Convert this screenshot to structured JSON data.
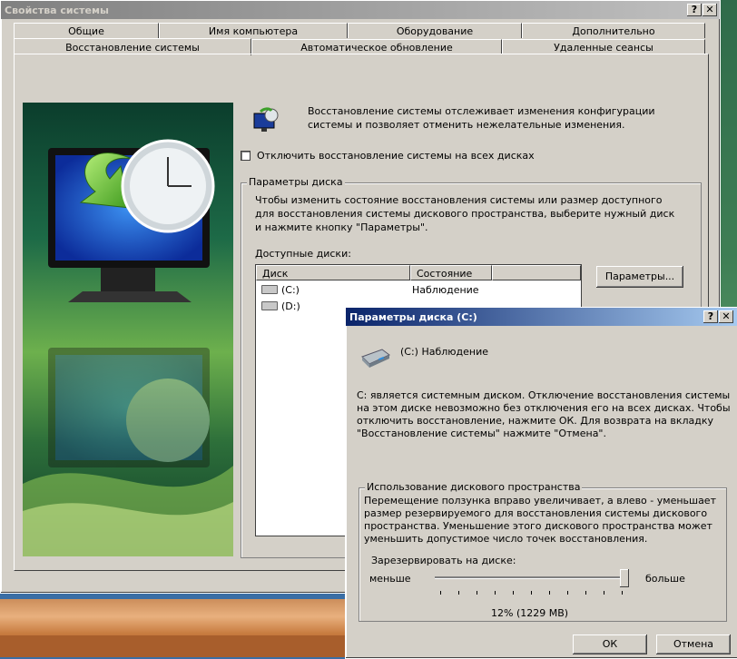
{
  "main_window": {
    "title": "Свойства системы",
    "help_btn": "?",
    "close_btn": "✕",
    "tabs_row1": [
      "Общие",
      "Имя компьютера",
      "Оборудование",
      "Дополнительно"
    ],
    "tabs_row2": [
      "Восстановление системы",
      "Автоматическое обновление",
      "Удаленные сеансы"
    ],
    "info_text": "Восстановление системы отслеживает изменения конфигурации системы и позволяет отменить нежелательные изменения.",
    "disable_checkbox_label": "Отключить восстановление системы на всех дисках",
    "disk_params_group": "Параметры диска",
    "disk_params_desc": "Чтобы изменить состояние восстановления системы или размер доступного для восстановления системы дискового пространства, выберите нужный диск и нажмите кнопку \"Параметры\".",
    "available_disks_label": "Доступные диски:",
    "list_columns": [
      "Диск",
      "Состояние"
    ],
    "disks": [
      {
        "name": "(C:)",
        "status": "Наблюдение"
      },
      {
        "name": "(D:)",
        "status": ""
      }
    ],
    "params_button": "Параметры..."
  },
  "dialog": {
    "title": "Параметры диска (C:)",
    "help_btn": "?",
    "close_btn": "✕",
    "drive_label": "(C:) Наблюдение",
    "warning_text": "C: является системным диском. Отключение восстановления системы на этом диске невозможно без отключения его на всех дисках. Чтобы отключить восстановление, нажмите ОК. Для возврата на вкладку \"Восстановление системы\" нажмите \"Отмена\".",
    "usage_group": "Использование дискового пространства",
    "usage_text": "Перемещение ползунка вправо увеличивает, а влево - уменьшает размер резервируемого для восстановления системы дискового пространства. Уменьшение этого дискового пространства может уменьшить допустимое число точек восстановления.",
    "reserve_label": "Зарезервировать на диске:",
    "less_label": "меньше",
    "more_label": "больше",
    "slider_fraction": 1.0,
    "reserved_value": "12% (1229 MB)",
    "ok_button": "ОК",
    "cancel_button": "Отмена"
  },
  "colors": {
    "title_active": "#0a246a",
    "title_inactive": "#808080",
    "face": "#d4d0c8"
  }
}
